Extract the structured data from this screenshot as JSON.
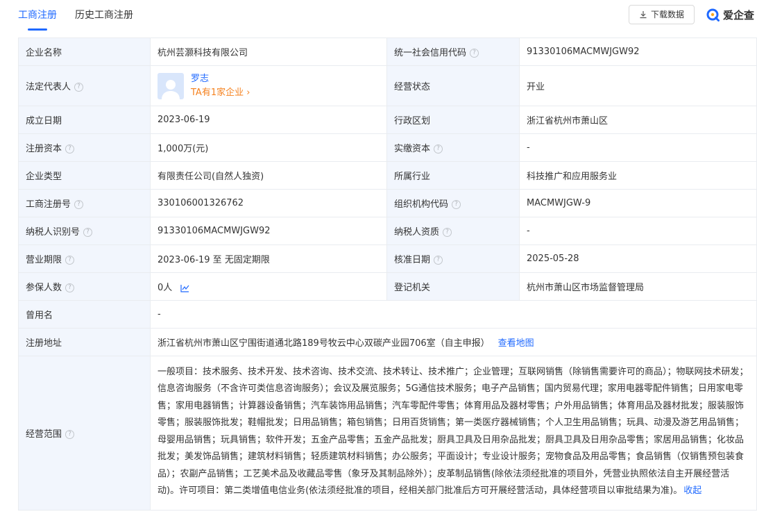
{
  "tabs": [
    {
      "label": "工商注册",
      "active": true
    },
    {
      "label": "历史工商注册",
      "active": false
    }
  ],
  "toolbar": {
    "download_label": "下载数据"
  },
  "brand": {
    "name": "爱企查"
  },
  "colors": {
    "accent": "#1f69ff",
    "orange": "#f5821f",
    "label_bg": "#f2f6fd",
    "border": "#e9ecf0"
  },
  "fields": {
    "company_name": {
      "label": "企业名称",
      "value": "杭州芸灏科技有限公司"
    },
    "credit_code": {
      "label": "统一社会信用代码",
      "value": "91330106MACMWJGW92"
    },
    "legal_rep": {
      "label": "法定代表人",
      "name": "罗志",
      "link": "TA有1家企业"
    },
    "status": {
      "label": "经营状态",
      "value": "开业"
    },
    "founded": {
      "label": "成立日期",
      "value": "2023-06-19"
    },
    "region": {
      "label": "行政区划",
      "value": "浙江省杭州市萧山区"
    },
    "reg_capital": {
      "label": "注册资本",
      "value": "1,000万(元)"
    },
    "paid_capital": {
      "label": "实缴资本",
      "value": "-"
    },
    "company_type": {
      "label": "企业类型",
      "value": "有限责任公司(自然人独资)"
    },
    "industry": {
      "label": "所属行业",
      "value": "科技推广和应用服务业"
    },
    "reg_no": {
      "label": "工商注册号",
      "value": "330106001326762"
    },
    "org_code": {
      "label": "组织机构代码",
      "value": "MACMWJGW-9"
    },
    "taxpayer_id": {
      "label": "纳税人识别号",
      "value": "91330106MACMWJGW92"
    },
    "taxpayer_qual": {
      "label": "纳税人资质",
      "value": "-"
    },
    "term": {
      "label": "营业期限",
      "value": "2023-06-19 至 无固定期限"
    },
    "approval_date": {
      "label": "核准日期",
      "value": "2025-05-28"
    },
    "insured": {
      "label": "参保人数",
      "value": "0人"
    },
    "authority": {
      "label": "登记机关",
      "value": "杭州市萧山区市场监督管理局"
    },
    "former_name": {
      "label": "曾用名",
      "value": "-"
    },
    "address": {
      "label": "注册地址",
      "value": "浙江省杭州市萧山区宁围街道通北路189号牧云中心双碳产业园706室（自主申报）",
      "link": "查看地图"
    },
    "scope": {
      "label": "经营范围",
      "value": "一般项目：技术服务、技术开发、技术咨询、技术交流、技术转让、技术推广；企业管理；互联网销售（除销售需要许可的商品）；物联网技术研发；信息咨询服务（不含许可类信息咨询服务）；会议及展览服务；5G通信技术服务；电子产品销售；国内贸易代理；家用电器零配件销售；日用家电零售；家用电器销售；计算器设备销售；汽车装饰用品销售；汽车零配件零售；体育用品及器材零售；户外用品销售；体育用品及器材批发；服装服饰零售；服装服饰批发；鞋帽批发；日用品销售；箱包销售；日用百货销售；第一类医疗器械销售；个人卫生用品销售；玩具、动漫及游艺用品销售；母婴用品销售；玩具销售；软件开发；五金产品零售；五金产品批发；厨具卫具及日用杂品批发；厨具卫具及日用杂品零售；家居用品销售；化妆品批发；美发饰品销售；建筑材料销售；轻质建筑材料销售；办公服务；平面设计；专业设计服务；宠物食品及用品零售；食品销售（仅销售预包装食品）；农副产品销售；工艺美术品及收藏品零售（象牙及其制品除外）；皮革制品销售(除依法须经批准的项目外，凭营业执照依法自主开展经营活动)。许可项目：第二类增值电信业务(依法须经批准的项目，经相关部门批准后方可开展经营活动，具体经营项目以审批结果为准)。",
      "collapse": "收起"
    }
  }
}
